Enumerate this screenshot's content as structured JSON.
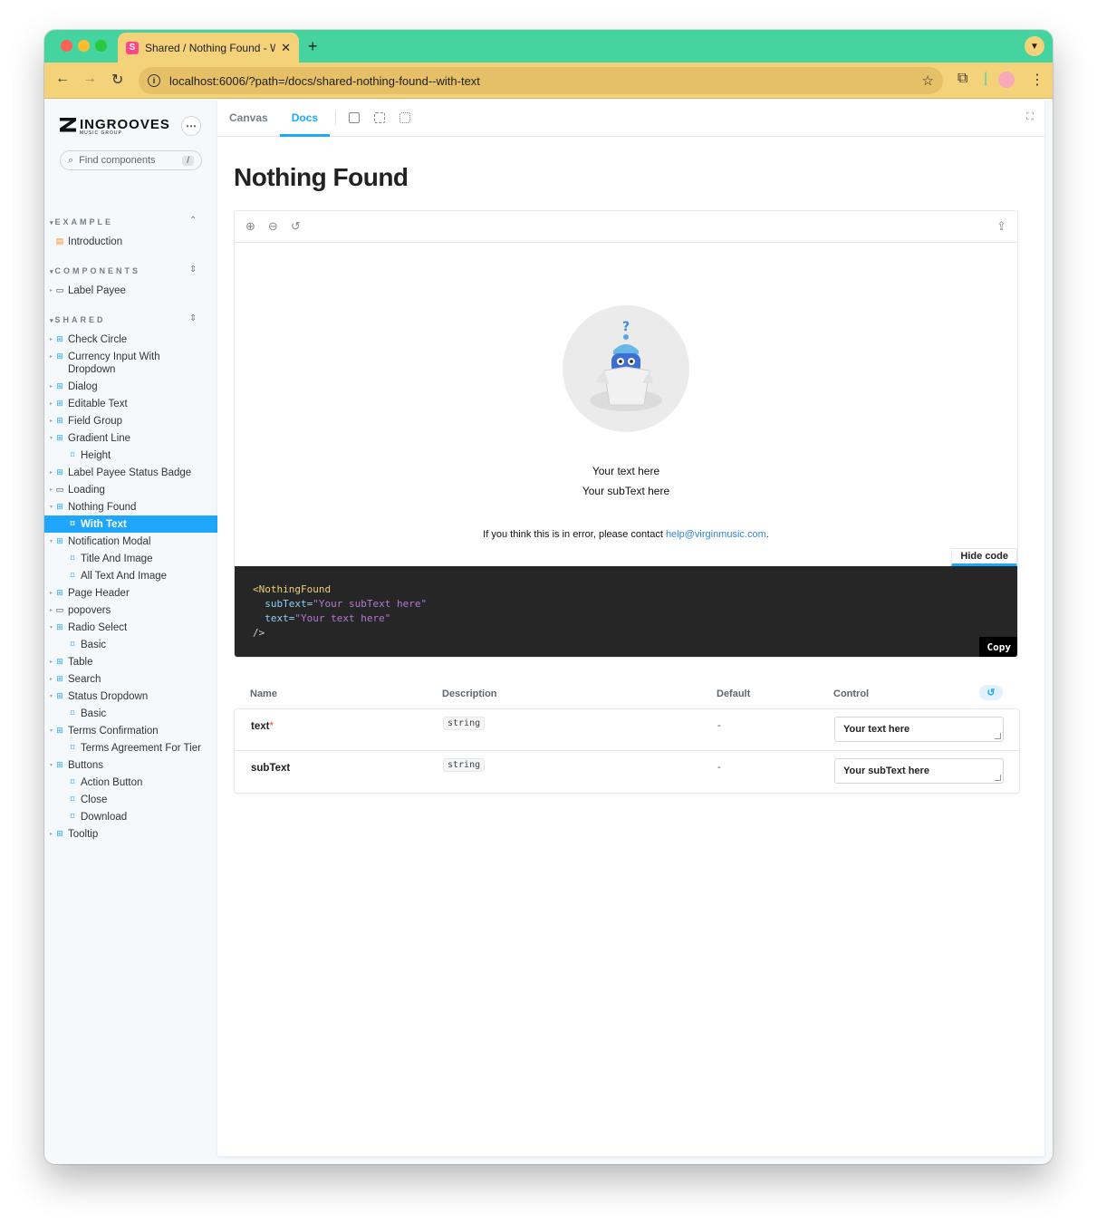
{
  "browser": {
    "tab_title": "Shared / Nothing Found - Wit",
    "tab_favicon": "S",
    "url": "localhost:6006/?path=/docs/shared-nothing-found--with-text"
  },
  "sidebar": {
    "brand": "INGROOVES",
    "brand_sub": "MUSIC GROUP",
    "search_placeholder": "Find components",
    "search_shortcut": "/",
    "sections": [
      {
        "label": "EXAMPLE"
      },
      {
        "label": "COMPONENTS"
      },
      {
        "label": "SHARED"
      }
    ],
    "items": [
      {
        "label": "Introduction"
      },
      {
        "label": "Label Payee"
      },
      {
        "label": "Check Circle"
      },
      {
        "label": "Currency Input With"
      },
      {
        "label": "Dropdown"
      },
      {
        "label": "Dialog"
      },
      {
        "label": "Editable Text"
      },
      {
        "label": "Field Group"
      },
      {
        "label": "Gradient Line"
      },
      {
        "label": "Height"
      },
      {
        "label": "Label Payee Status Badge"
      },
      {
        "label": "Loading"
      },
      {
        "label": "Nothing Found"
      },
      {
        "label": "With Text"
      },
      {
        "label": "Notification Modal"
      },
      {
        "label": "Title And Image"
      },
      {
        "label": "All Text And Image"
      },
      {
        "label": "Page Header"
      },
      {
        "label": "popovers"
      },
      {
        "label": "Radio Select"
      },
      {
        "label": "Basic"
      },
      {
        "label": "Table"
      },
      {
        "label": "Search"
      },
      {
        "label": "Status Dropdown"
      },
      {
        "label": "Basic"
      },
      {
        "label": "Terms Confirmation"
      },
      {
        "label": "Terms Agreement For Tier"
      },
      {
        "label": "Buttons"
      },
      {
        "label": "Action Button"
      },
      {
        "label": "Close"
      },
      {
        "label": "Download"
      },
      {
        "label": "Tooltip"
      }
    ]
  },
  "toolbar": {
    "canvas_tab": "Canvas",
    "docs_tab": "Docs"
  },
  "docs": {
    "title": "Nothing Found",
    "preview": {
      "text": "Your text here",
      "subtext": "Your subText here",
      "error_prefix": "If you think this is in error, please contact ",
      "email": "help@virginmusic.com",
      "error_suffix": ".",
      "hide_code": "Hide code"
    },
    "code": {
      "line1_tag": "<NothingFound",
      "line2_attr": "subText=",
      "line2_val": "\"Your subText here\"",
      "line3_attr": "text=",
      "line3_val": "\"Your text here\"",
      "line4": "/>",
      "copy": "Copy"
    },
    "args": {
      "headers": {
        "name": "Name",
        "description": "Description",
        "default": "Default",
        "control": "Control"
      },
      "rows": [
        {
          "name": "text",
          "required": "*",
          "type": "string",
          "default": "-",
          "value": "Your text here"
        },
        {
          "name": "subText",
          "type": "string",
          "default": "-",
          "value": "Your subText here"
        }
      ]
    }
  }
}
